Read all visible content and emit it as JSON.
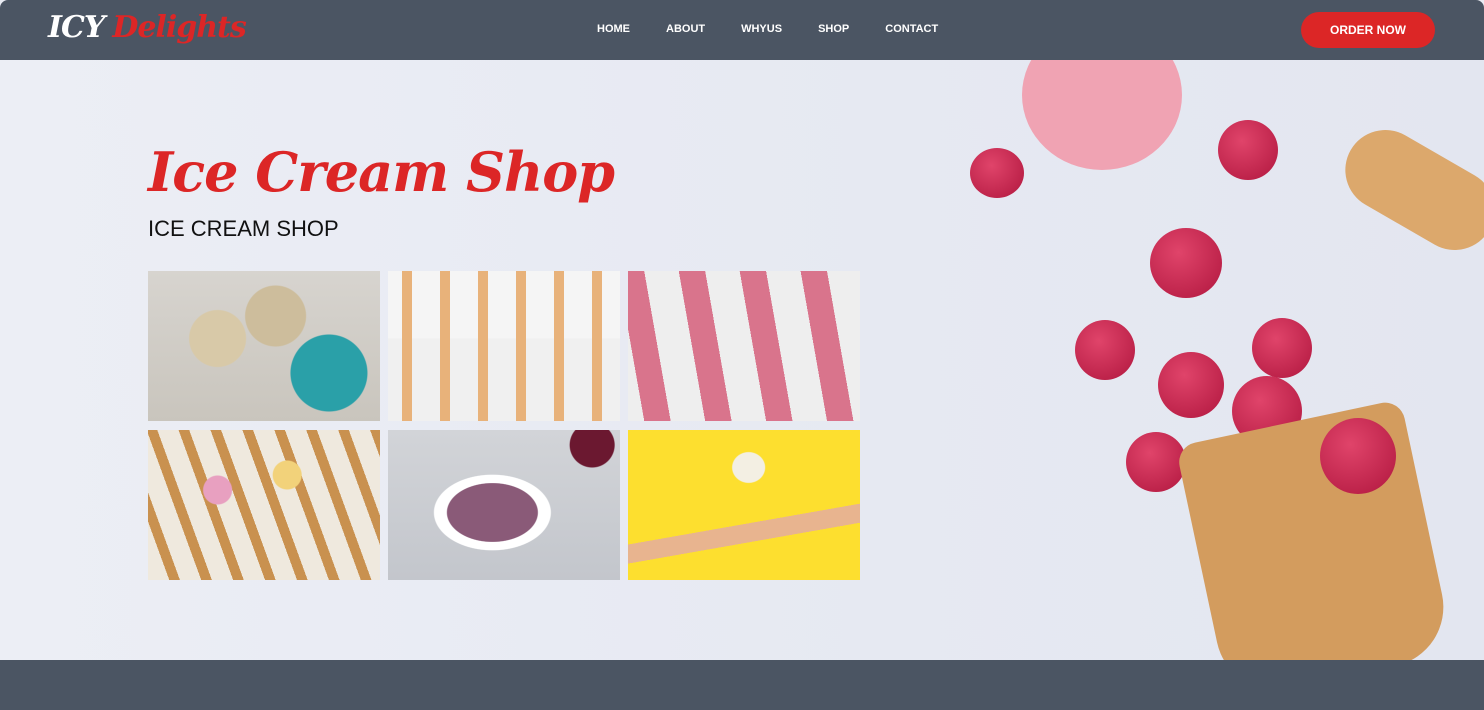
{
  "header": {
    "logo_part1": "ICY",
    "logo_part2": "Delights",
    "nav": [
      "HOME",
      "ABOUT",
      "WHYUS",
      "SHOP",
      "CONTACT"
    ],
    "order_button": "ORDER NOW"
  },
  "hero": {
    "title": "Ice Cream Shop",
    "subtitle": "ICE CREAM SHOP",
    "gallery": [
      "ice-cream-bowls-photo",
      "strawberry-cones-photo",
      "popsicles-photo",
      "flower-cones-photo",
      "blueberry-bowl-photo",
      "hand-holding-cone-photo"
    ]
  },
  "colors": {
    "header_bg": "#4b5563",
    "accent": "#dc2626"
  }
}
